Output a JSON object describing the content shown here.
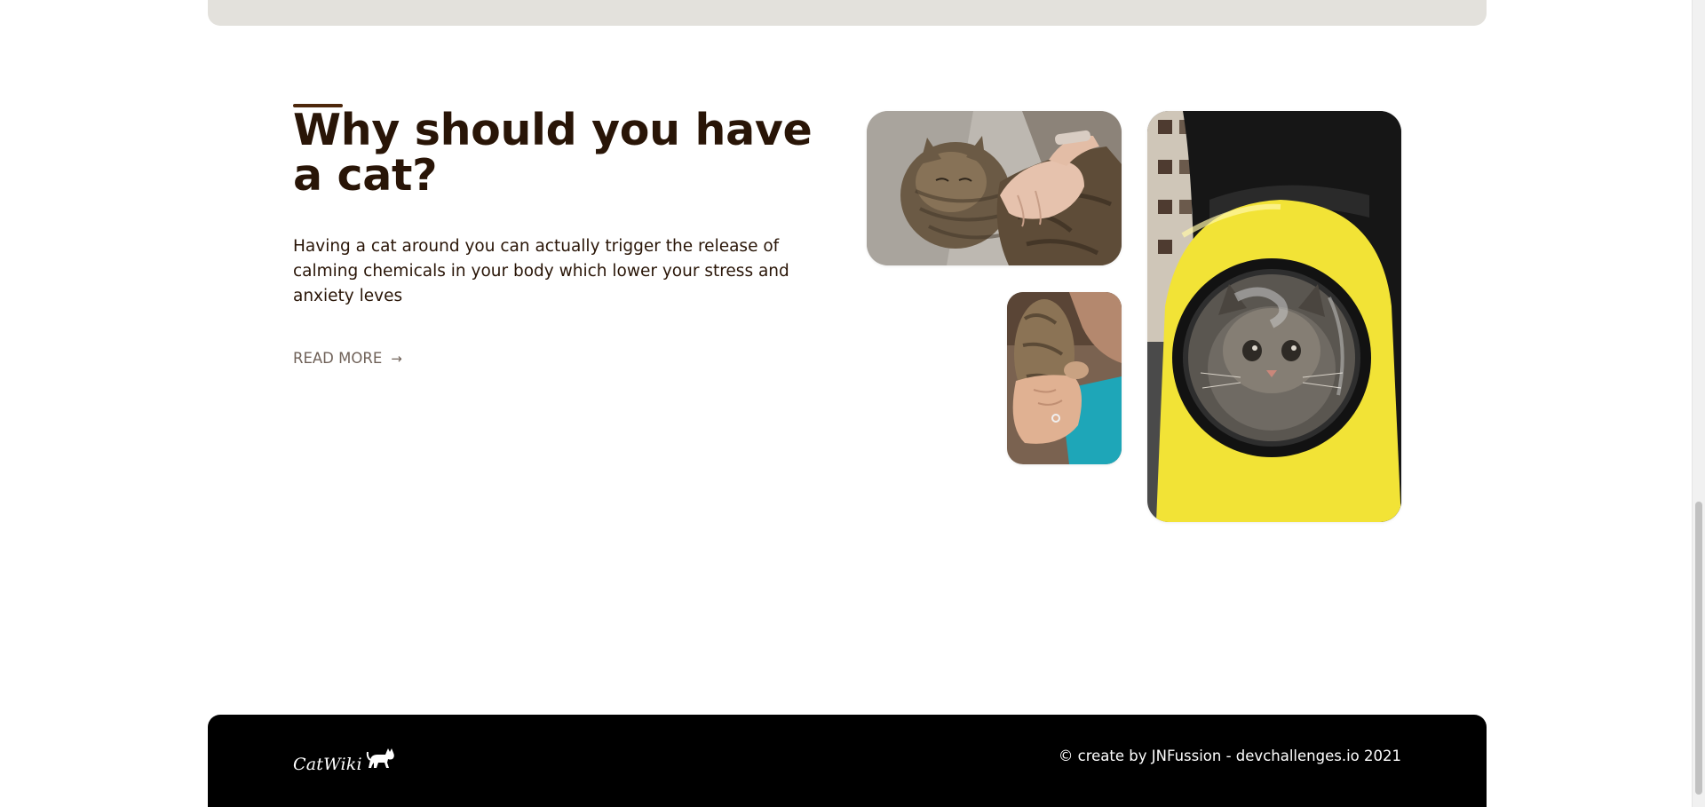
{
  "why_section": {
    "title": "Why should you have a cat?",
    "text": "Having a cat around you can actually trigger the release of calming chemicals in your body which lower your stress and anxiety leves",
    "read_more": "READ MORE",
    "read_more_icon": "arrow-right-icon",
    "photos": [
      {
        "name": "cat-sleeping-in-arms-photo"
      },
      {
        "name": "cat-held-by-person-photo"
      },
      {
        "name": "cat-in-yellow-backpack-photo"
      }
    ]
  },
  "footer": {
    "logo_text": "CatWiki",
    "logo_icon": "cat-icon",
    "copyright": "© create by JNFussion - devchallenges.io 2021"
  },
  "colors": {
    "accent": "#4d270c",
    "title": "#291507",
    "top_card": "#e3e1dc",
    "footer_bg": "#000000"
  }
}
